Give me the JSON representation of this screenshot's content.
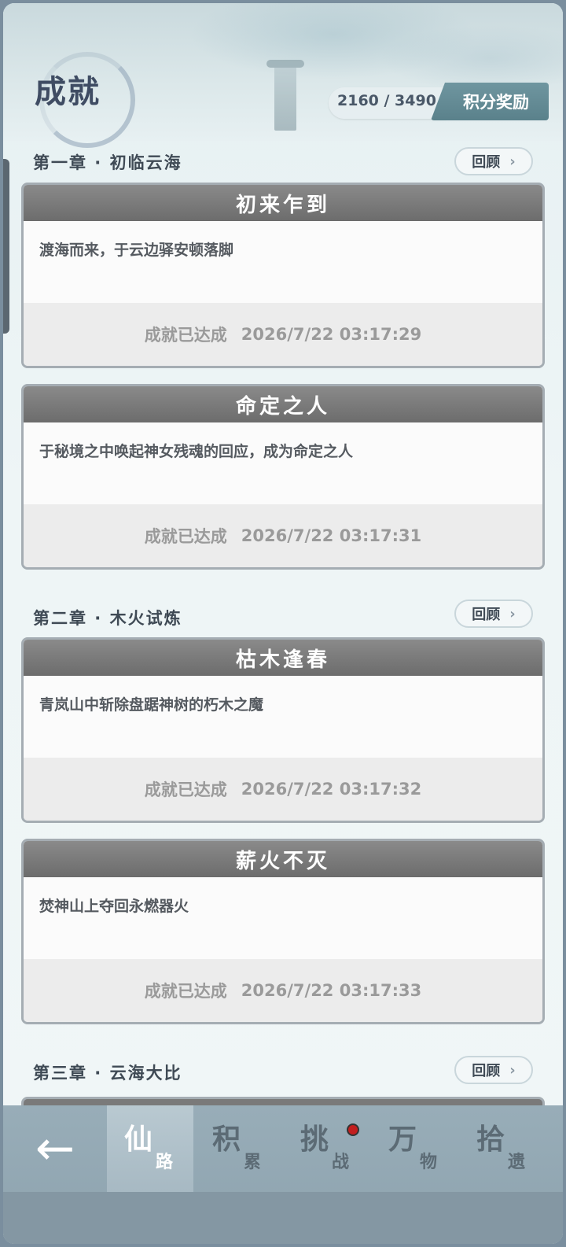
{
  "header": {
    "title": "成就",
    "score": "2160 / 3490",
    "reward_button": "积分奖励"
  },
  "chapters": [
    {
      "title": "第一章 · 初临云海",
      "review": "回顾"
    },
    {
      "title": "第二章 · 木火试炼",
      "review": "回顾"
    },
    {
      "title": "第三章 · 云海大比",
      "review": "回顾"
    }
  ],
  "cards": [
    {
      "name": "初来乍到",
      "desc": "渡海而来，于云边驿安顿落脚",
      "status": "成就已达成",
      "time": "2026/7/22 03:17:29"
    },
    {
      "name": "命定之人",
      "desc": "于秘境之中唤起神女残魂的回应，成为命定之人",
      "status": "成就已达成",
      "time": "2026/7/22 03:17:31"
    },
    {
      "name": "枯木逢春",
      "desc": "青岚山中斩除盘踞神树的朽木之魔",
      "status": "成就已达成",
      "time": "2026/7/22 03:17:32"
    },
    {
      "name": "薪火不灭",
      "desc": "焚神山上夺回永燃器火",
      "status": "成就已达成",
      "time": "2026/7/22 03:17:33"
    }
  ],
  "nav": {
    "back": "←",
    "tabs": [
      {
        "big": "仙",
        "small": "路"
      },
      {
        "big": "积",
        "small": "累"
      },
      {
        "big": "挑",
        "small": "战"
      },
      {
        "big": "万",
        "small": "物"
      },
      {
        "big": "拾",
        "small": "遗"
      }
    ]
  },
  "colors": {
    "accent": "#5a818b",
    "card_header": "#7a7a7a",
    "badge": "#c21e1e"
  }
}
